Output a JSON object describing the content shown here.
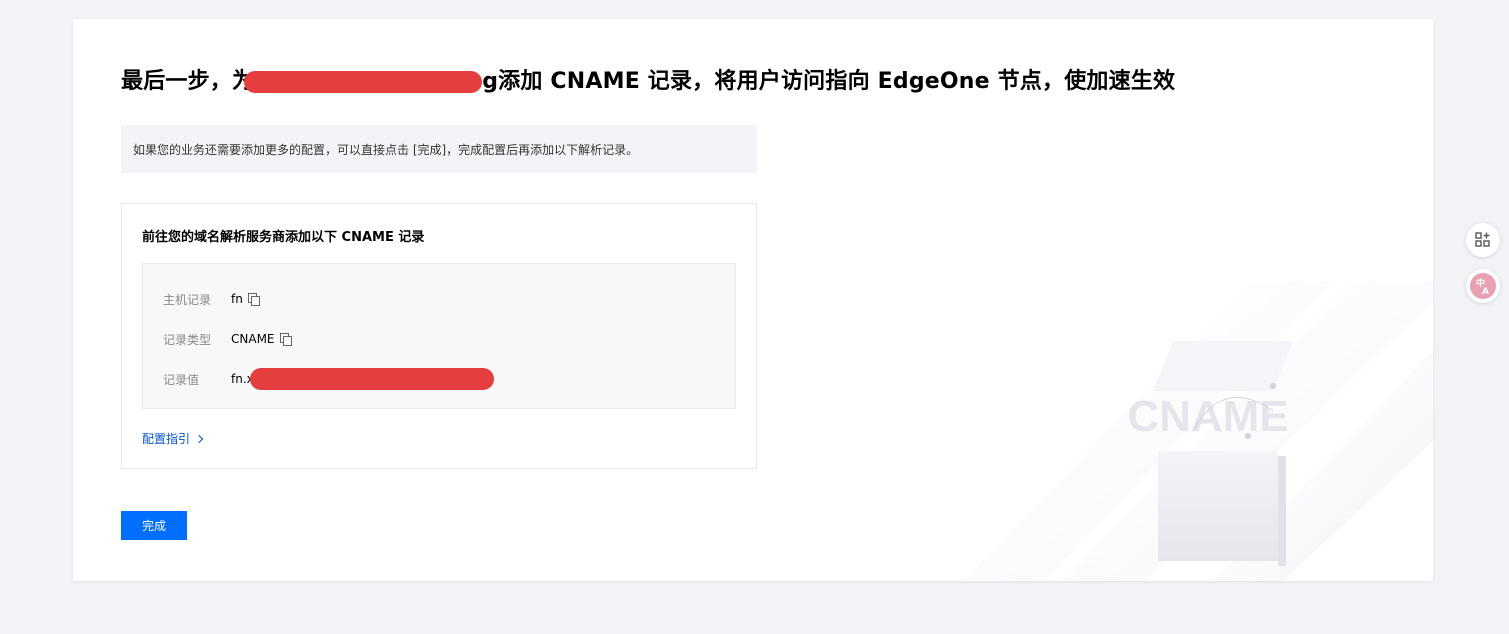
{
  "header": {
    "title_prefix": "最后一步，为",
    "title_mid": "g",
    "title_suffix": "添加 CNAME 记录，将用户访问指向 EdgeOne 节点，使加速生效"
  },
  "notice": {
    "text": "如果您的业务还需要添加更多的配置，可以直接点击 [完成]，完成配置后再添加以下解析记录。"
  },
  "cname_box": {
    "title": "前往您的域名解析服务商添加以下 CNAME 记录",
    "records": [
      {
        "label": "主机记录",
        "value": "fn",
        "copyable": true
      },
      {
        "label": "记录类型",
        "value": "CNAME",
        "copyable": true
      },
      {
        "label": "记录值",
        "value": "fn.x",
        "copyable": false
      }
    ],
    "guide_link": "配置指引"
  },
  "actions": {
    "done_label": "完成"
  },
  "illustration": {
    "text": "CNAME"
  },
  "floating": {
    "top_icon": "apps-add-icon",
    "bottom_icon": "translate-icon"
  },
  "colors": {
    "primary": "#006eff",
    "link": "#0052d9",
    "redaction": "#e53e3e"
  }
}
